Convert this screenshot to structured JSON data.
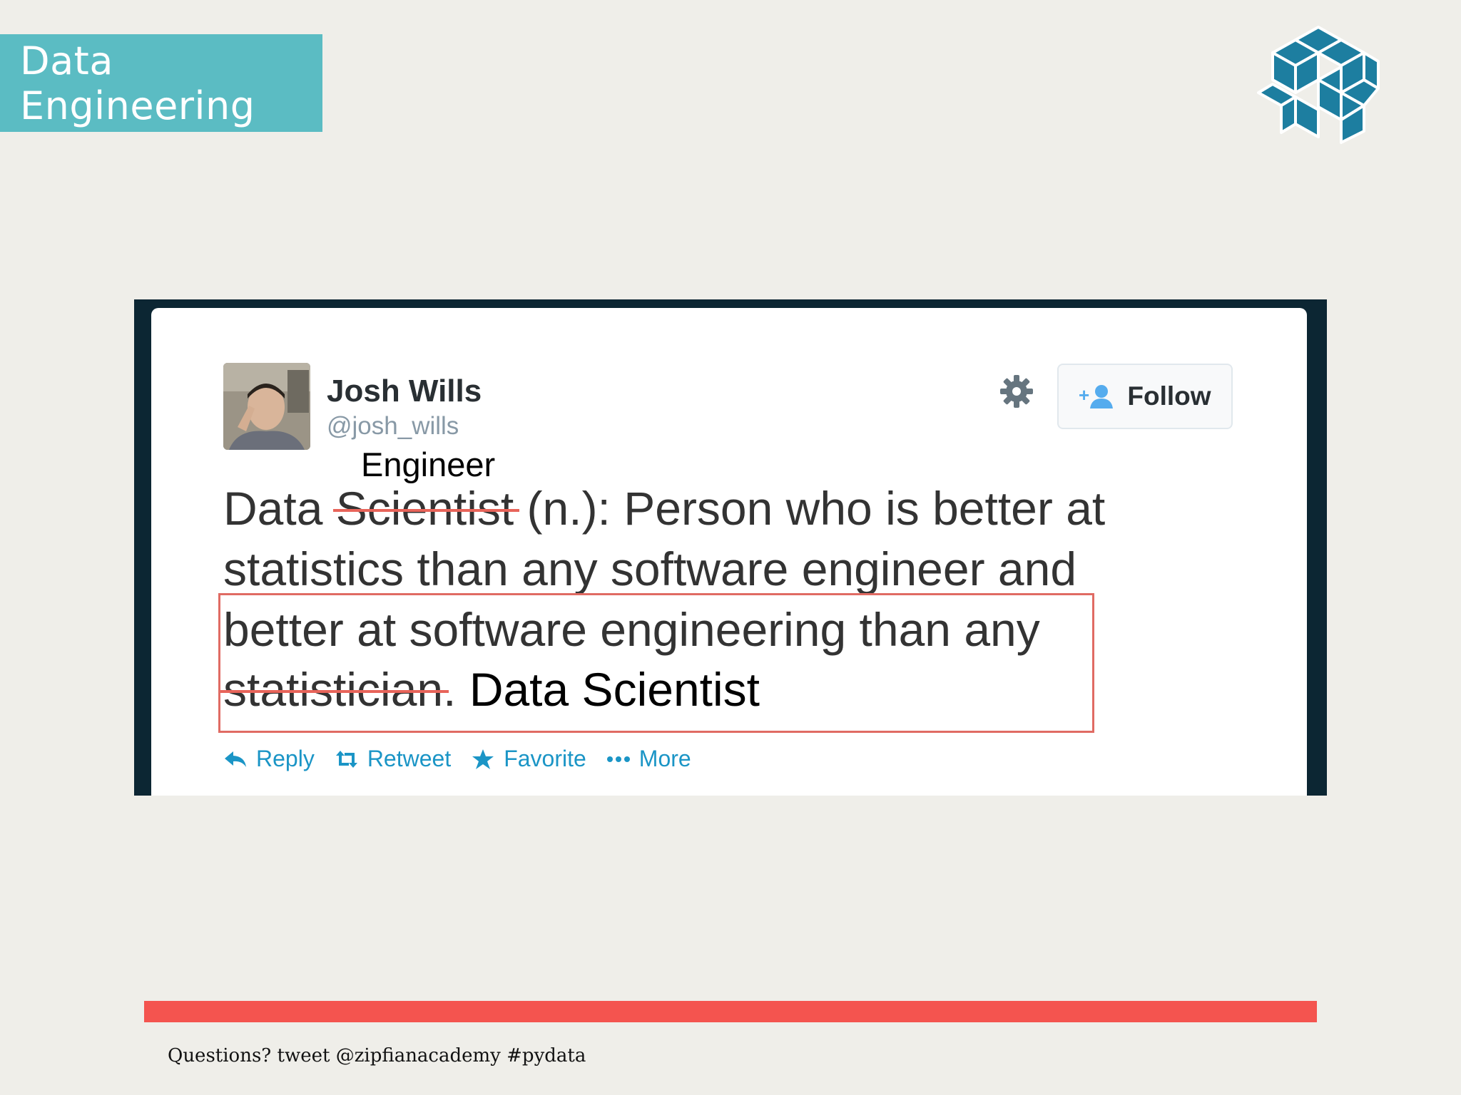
{
  "slide": {
    "title": "Data Engineering",
    "footer": "Questions? tweet @zipfianacademy #pydata",
    "colors": {
      "title_bg": "#5bbcc3",
      "logo": "#1d7ea0",
      "accent_bar": "#f4544f",
      "annotation": "#e06b63"
    }
  },
  "tweet": {
    "author_name": "Josh Wills",
    "author_handle": "@josh_wills",
    "follow_label": "Follow",
    "text": {
      "w_data": "Data",
      "w_scientist": "Scientist",
      "rest1": "(n.): Person who is better at",
      "line2": "statistics than any software engineer and",
      "line3": "better at software engineering than any",
      "w_statistician": "statistician",
      "period": "."
    },
    "actions": [
      {
        "label": "Reply",
        "icon": "reply-icon"
      },
      {
        "label": "Retweet",
        "icon": "retweet-icon"
      },
      {
        "label": "Favorite",
        "icon": "star-icon"
      },
      {
        "label": "More",
        "icon": "more-icon"
      }
    ]
  },
  "annotations": {
    "engineer": "Engineer",
    "data_scientist": "Data Scientist"
  }
}
